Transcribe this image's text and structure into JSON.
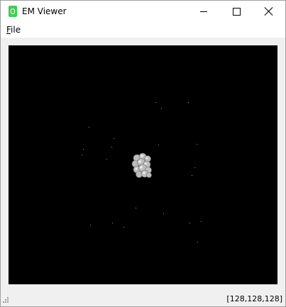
{
  "window": {
    "title": "EM Viewer"
  },
  "menubar": {
    "file_prefix": "F",
    "file_rest": "ile"
  },
  "viewport": {
    "background": "#000000",
    "content": "3D electron microscopy density render"
  },
  "statusbar": {
    "dimensions": "[128,128,128]"
  },
  "icons": {
    "app": "qt-app-icon",
    "minimize": "minimize-icon",
    "maximize": "maximize-icon",
    "close": "close-icon",
    "grip": "size-grip-icon"
  },
  "colors": {
    "titlebar": "#ffffff",
    "window_bg": "#f0f0f0",
    "app_icon": "#41cd52"
  }
}
